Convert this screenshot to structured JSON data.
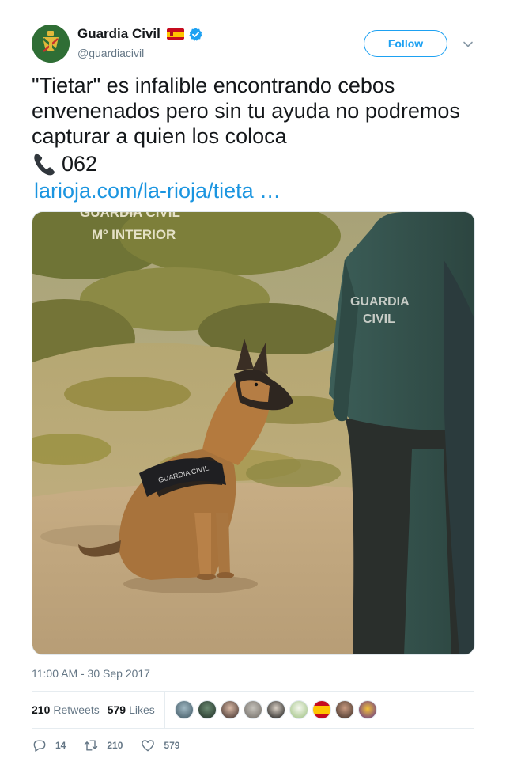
{
  "user": {
    "display_name": "Guardia Civil",
    "handle": "@guardiacivil",
    "flag_icon": "spain-flag-icon",
    "verified_icon": "verified-badge-icon",
    "verified_color": "#1da1f2"
  },
  "header": {
    "follow_label": "Follow",
    "menu_icon": "chevron-down-icon"
  },
  "tweet": {
    "text": "\"Tietar\" es infalible encontrando cebos envenenados pero sin tu ayuda no podremos capturar a quien los coloca",
    "phone_icon": "telephone-receiver-icon",
    "phone_number": "062",
    "link_text": "larioja.com/la-rioja/tieta …",
    "timestamp": "11:00 AM - 30 Sep 2017"
  },
  "media": {
    "watermark_line1": "GUARDIA CIVIL",
    "watermark_line2": "Mº INTERIOR",
    "jacket_text_line1": "GUARDIA",
    "jacket_text_line2": "CIVIL",
    "harness_text": "GUARDIA CIVIL"
  },
  "stats": {
    "retweets_count": "210",
    "retweets_label": "Retweets",
    "likes_count": "579",
    "likes_label": "Likes"
  },
  "actions": {
    "reply_count": "14",
    "retweet_count": "210",
    "like_count": "579"
  },
  "colors": {
    "link": "#1b95e0",
    "secondary_text": "#657786",
    "brand_blue": "#1da1f2"
  }
}
